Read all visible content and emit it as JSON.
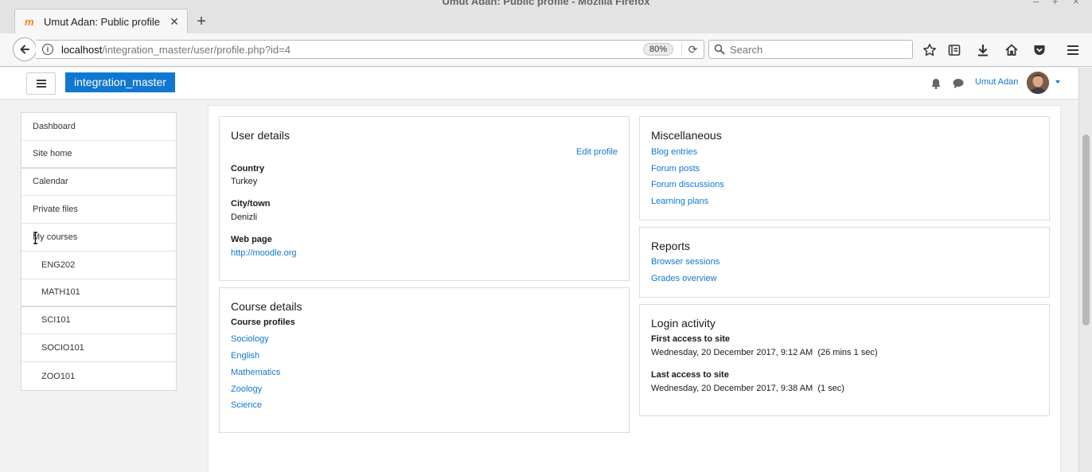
{
  "window": {
    "title": "Umut Adan: Public profile - Mozilla Firefox"
  },
  "browser": {
    "tab_title": "Umut Adan: Public profile",
    "url_host": "localhost",
    "url_path": "/integration_master/user/profile.php?id=4",
    "zoom": "80%",
    "search_placeholder": "Search"
  },
  "header": {
    "site_name": "integration_master",
    "user_name": "Umut Adan"
  },
  "nav": {
    "items": [
      {
        "label": "Dashboard"
      },
      {
        "label": "Site home"
      },
      {
        "label": "Calendar"
      },
      {
        "label": "Private files"
      },
      {
        "label": "My courses"
      },
      {
        "label": "ENG202"
      },
      {
        "label": "MATH101"
      },
      {
        "label": "SCI101"
      },
      {
        "label": "SOCIO101"
      },
      {
        "label": "ZOO101"
      }
    ]
  },
  "user_details": {
    "title": "User details",
    "edit_link": "Edit profile",
    "country_label": "Country",
    "country_value": "Turkey",
    "city_label": "City/town",
    "city_value": "Denizli",
    "webpage_label": "Web page",
    "webpage_value": "http://moodle.org"
  },
  "course_details": {
    "title": "Course details",
    "profiles_label": "Course profiles",
    "courses": [
      "Sociology",
      "English",
      "Mathematics",
      "Zoology",
      "Science"
    ]
  },
  "miscellaneous": {
    "title": "Miscellaneous",
    "links": [
      "Blog entries",
      "Forum posts",
      "Forum discussions",
      "Learning plans"
    ]
  },
  "reports": {
    "title": "Reports",
    "links": [
      "Browser sessions",
      "Grades overview"
    ]
  },
  "login_activity": {
    "title": "Login activity",
    "first_label": "First access to site",
    "first_value": "Wednesday, 20 December 2017, 9:12 AM  (26 mins 1 sec)",
    "last_label": "Last access to site",
    "last_value": "Wednesday, 20 December 2017, 9:38 AM  (1 sec)"
  },
  "colors": {
    "brand": "#1177d1",
    "link": "#1177d1"
  }
}
